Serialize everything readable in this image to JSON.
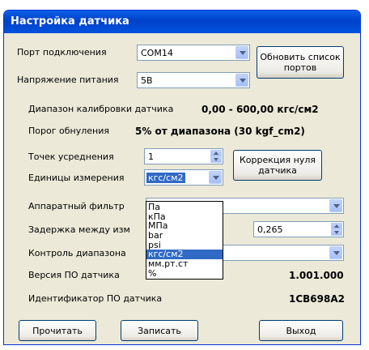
{
  "window": {
    "title": "Настройка датчика"
  },
  "port": {
    "label": "Порт подключения",
    "value": "COM14"
  },
  "voltage": {
    "label": "Напряжение питания",
    "value": "5В"
  },
  "refresh_button": "Обновить список портов",
  "calibration": {
    "label": "Диапазон калибровки датчика",
    "value": "0,00 - 600,00 кгс/см2"
  },
  "zero_threshold": {
    "label": "Порог обнуления",
    "value": "5% от диапазона (30 kgf_cm2)"
  },
  "averaging": {
    "label": "Точек усреднения",
    "value": "1"
  },
  "zero_correction_button": "Коррекция нуля датчика",
  "units": {
    "label": "Единицы измерения",
    "value": "кгс/см2",
    "options": [
      "Па",
      "кПа",
      "МПа",
      "bar",
      "psi",
      "кгс/см2",
      "мм.рт.ст",
      "%"
    ],
    "selected_index": 5
  },
  "hw_filter": {
    "label": "Аппаратный фильтр"
  },
  "delay": {
    "label": "Задержка между изм",
    "value": "0,265"
  },
  "range_control": {
    "label": "Контроль диапазона"
  },
  "firmware": {
    "label": "Версия ПО датчика",
    "value": "1.001.000"
  },
  "firmware_id": {
    "label": "Идентификатор ПО датчика",
    "value": "1CB698A2"
  },
  "buttons": {
    "read": "Прочитать",
    "write": "Записать",
    "exit": "Выход"
  }
}
